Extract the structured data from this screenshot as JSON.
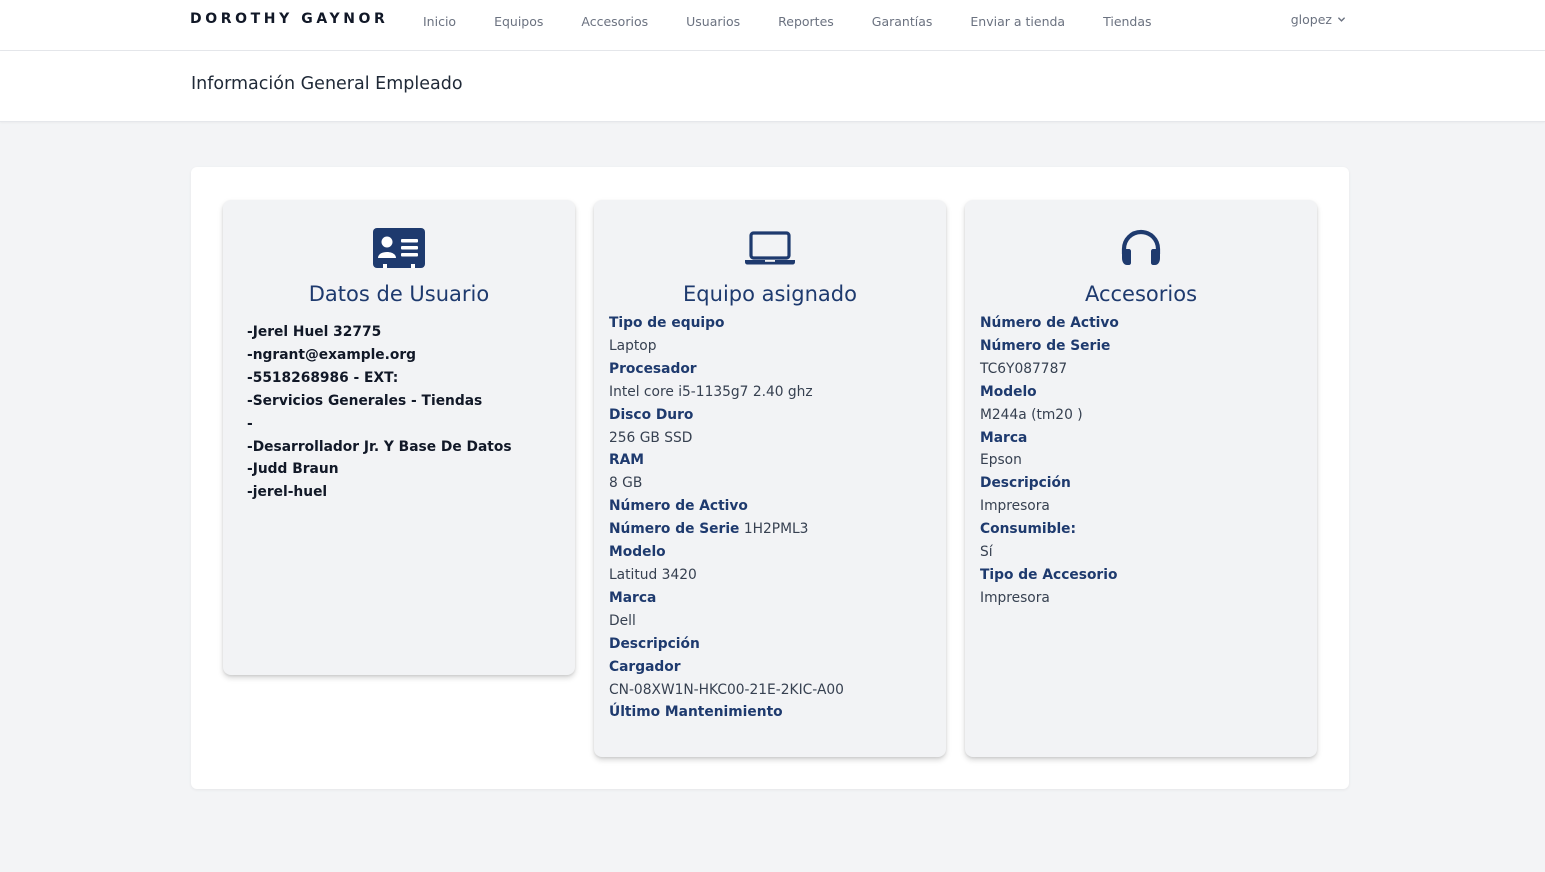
{
  "nav": {
    "brand": "DOROTHY GAYNOR",
    "links": [
      "Inicio",
      "Equipos",
      "Accesorios",
      "Usuarios",
      "Reportes",
      "Garantías",
      "Enviar a tienda",
      "Tiendas"
    ],
    "user": "glopez"
  },
  "header": {
    "title": "Información General Empleado"
  },
  "user_card": {
    "icon": "id-card-icon",
    "title": "Datos de Usuario",
    "lines": [
      "-Jerel Huel 32775",
      "-ngrant@example.org",
      "-5518268986 - EXT:",
      "-Servicios Generales - Tiendas",
      "-",
      "-Desarrollador Jr. Y Base De Datos",
      "-Judd Braun",
      "-jerel-huel"
    ]
  },
  "equipment_card": {
    "icon": "laptop-icon",
    "title": "Equipo asignado",
    "tipo_label": "Tipo de equipo",
    "tipo_value": "Laptop",
    "procesador_label": "Procesador",
    "procesador_value": "Intel core i5-1135g7 2.40 ghz",
    "disco_label": "Disco Duro",
    "disco_value": "256 GB SSD",
    "ram_label": "RAM",
    "ram_value": "8 GB",
    "activo_label": "Número de Activo",
    "serie_label": "Número de Serie",
    "serie_value": "1H2PML3",
    "modelo_label": "Modelo",
    "modelo_value": "Latitud 3420",
    "marca_label": "Marca",
    "marca_value": "Dell",
    "descripcion_label": "Descripción",
    "cargador_label": "Cargador",
    "cargador_value": "CN-08XW1N-HKC00-21E-2KIC-A00",
    "mantenimiento_label": "Último Mantenimiento"
  },
  "accessories_card": {
    "icon": "headphones-icon",
    "title": "Accesorios",
    "activo_label": "Número de Activo",
    "serie_label": "Número de Serie",
    "serie_value": "TC6Y087787",
    "modelo_label": "Modelo",
    "modelo_value": "M244a (tm20 )",
    "marca_label": "Marca",
    "marca_value": "Epson",
    "descripcion_label": "Descripción",
    "descripcion_value": "Impresora",
    "consumible_label": "Consumible:",
    "consumible_value": "Sí",
    "tipo_label": "Tipo de Accesorio",
    "tipo_value": "Impresora"
  },
  "colors": {
    "accent": "#1e3a6e",
    "background": "#f3f4f6",
    "card": "#f2f3f5"
  }
}
